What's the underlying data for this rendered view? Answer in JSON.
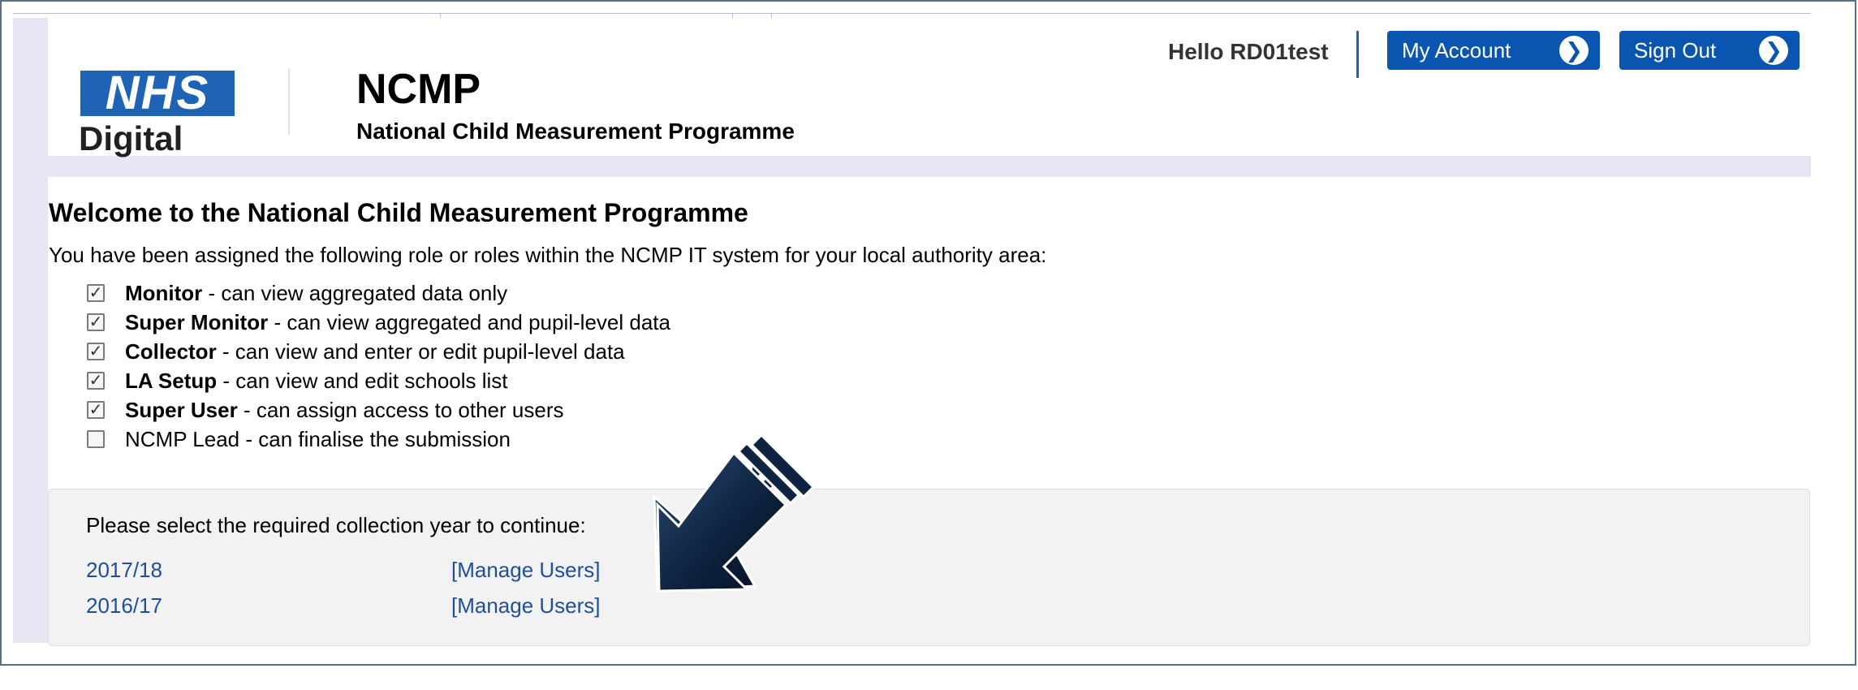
{
  "header": {
    "logo": {
      "brand": "NHS",
      "sub": "Digital"
    },
    "title": "NCMP",
    "subtitle": "National Child Measurement Programme",
    "greeting": "Hello RD01test",
    "buttons": {
      "account": "My Account",
      "signout": "Sign Out"
    },
    "brand_color": "#1e63b5"
  },
  "main": {
    "heading": "Welcome to the National Child Measurement Programme",
    "intro": "You have been assigned the following role or roles within the NCMP IT system for your local authority area:",
    "roles": [
      {
        "name": "Monitor",
        "description": " - can view aggregated data only",
        "checked": true
      },
      {
        "name": "Super Monitor",
        "description": " - can view aggregated and pupil-level data",
        "checked": true
      },
      {
        "name": "Collector",
        "description": " - can view and enter or edit pupil-level data",
        "checked": true
      },
      {
        "name": "LA Setup",
        "description": " - can view and edit schools list",
        "checked": true
      },
      {
        "name": "Super User",
        "description": " - can assign access to other users",
        "checked": true
      },
      {
        "name": "NCMP Lead",
        "description": " - can finalise the submission",
        "checked": false
      }
    ]
  },
  "collection": {
    "prompt": "Please select the required collection year to continue:",
    "years": [
      {
        "year": "2017/18",
        "manage": "[Manage Users]"
      },
      {
        "year": "2016/17",
        "manage": "[Manage Users]"
      }
    ],
    "link_color": "#1f4e9a"
  },
  "annotation": {
    "arrow_icon": "arrow-down-left-icon",
    "color": "#0d2340"
  }
}
